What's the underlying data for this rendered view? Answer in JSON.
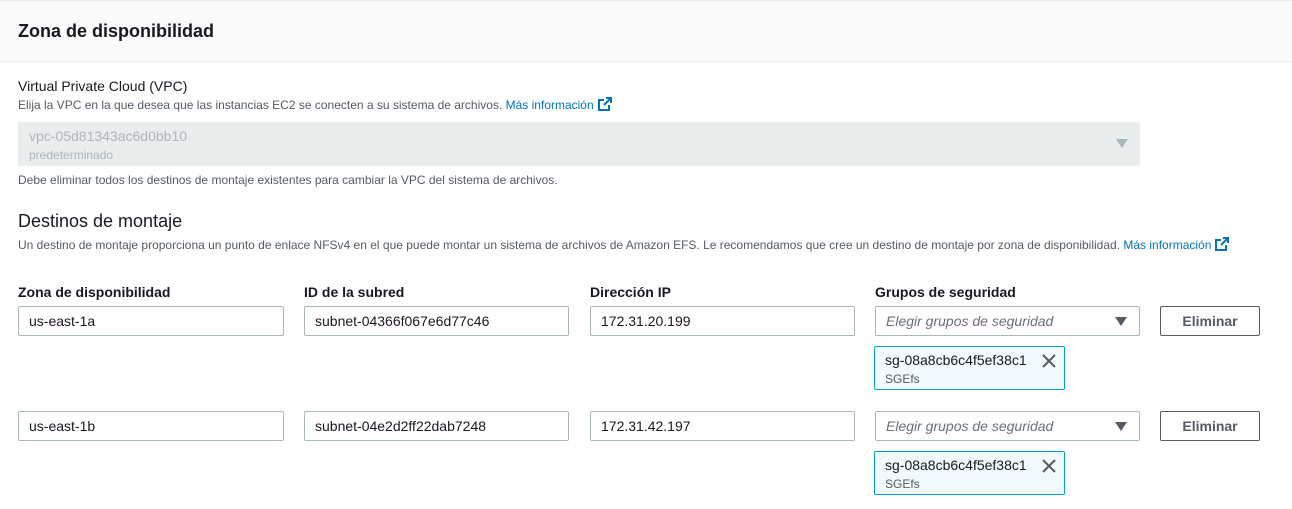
{
  "header": {
    "title": "Zona de disponibilidad"
  },
  "vpc": {
    "label": "Virtual Private Cloud (VPC)",
    "description": "Elija la VPC en la que desea que las instancias EC2 se conecten a su sistema de archivos.",
    "link": "Más información",
    "selected_value": "vpc-05d81343ac6d0bb10",
    "selected_sub": "predeterminado",
    "note": "Debe eliminar todos los destinos de montaje existentes para cambiar la VPC del sistema de archivos."
  },
  "mount_targets": {
    "title": "Destinos de montaje",
    "description": "Un destino de montaje proporciona un punto de enlace NFSv4 en el que puede montar un sistema de archivos de Amazon EFS. Le recomendamos que cree un destino de montaje por zona de disponibilidad.",
    "link": "Más información",
    "columns": [
      "Zona de disponibilidad",
      "ID de la subred",
      "Dirección IP",
      "Grupos de seguridad"
    ],
    "rows": [
      {
        "az": "us-east-1a",
        "subnet": "subnet-04366f067e6d77c46",
        "ip": "172.31.20.199",
        "sg_placeholder": "Elegir grupos de seguridad",
        "remove_label": "Eliminar",
        "token_id": "sg-08a8cb6c4f5ef38c1",
        "token_name": "SGEfs"
      },
      {
        "az": "us-east-1b",
        "subnet": "subnet-04e2d2ff22dab7248",
        "ip": "172.31.42.197",
        "sg_placeholder": "Elegir grupos de seguridad",
        "remove_label": "Eliminar",
        "token_id": "sg-08a8cb6c4f5ef38c1",
        "token_name": "SGEfs"
      }
    ]
  },
  "icons": {
    "external": "external-link-icon",
    "caret": "caret-down-icon",
    "close": "close-icon"
  },
  "colors": {
    "link": "#0073bb",
    "token_border": "#00a1c9",
    "token_bg": "#f1faff"
  }
}
